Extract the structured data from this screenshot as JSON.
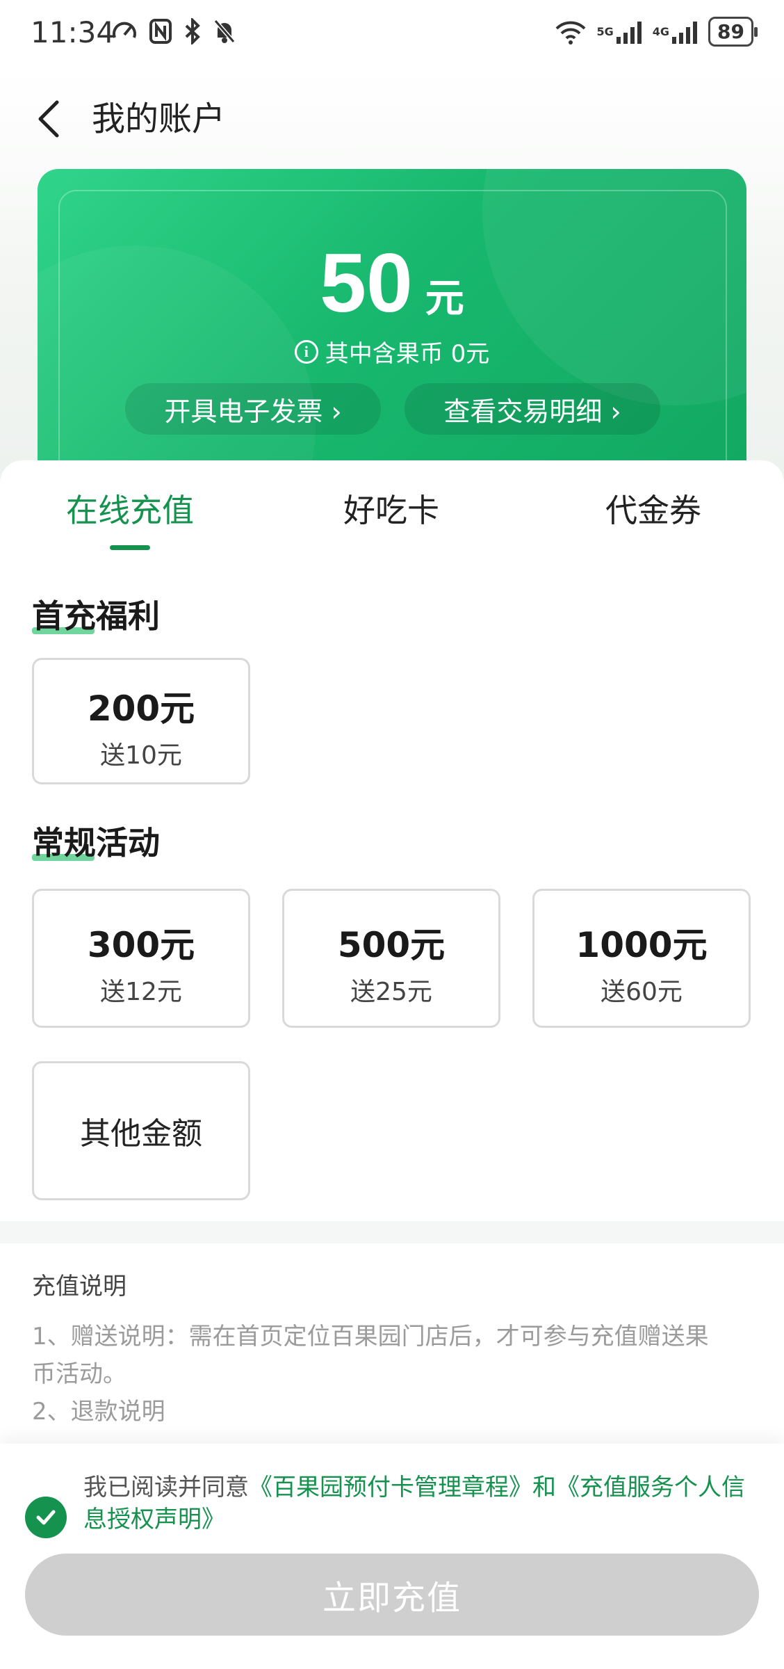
{
  "status_bar": {
    "time": "11:34",
    "battery": "89",
    "network_5g": "5G",
    "network_4g": "4G",
    "icons_left": [
      "speed-icon",
      "nfc-icon",
      "bluetooth-icon",
      "mute-bell-icon"
    ],
    "icons_right": [
      "wifi-icon",
      "signal-icon",
      "signal-icon"
    ]
  },
  "header": {
    "title": "我的账户"
  },
  "balance": {
    "amount": "50",
    "unit": "元",
    "sub_text": "其中含果币 0元",
    "invoice_btn": "开具电子发票 ›",
    "detail_btn": "查看交易明细 ›"
  },
  "tabs": [
    {
      "label": "在线充值",
      "active": true
    },
    {
      "label": "好吃卡",
      "active": false
    },
    {
      "label": "代金券",
      "active": false
    }
  ],
  "first_charge": {
    "title": "首充福利",
    "options": [
      {
        "amount": "200元",
        "gift": "送10元"
      }
    ]
  },
  "regular": {
    "title": "常规活动",
    "options": [
      {
        "amount": "300元",
        "gift": "送12元"
      },
      {
        "amount": "500元",
        "gift": "送25元"
      },
      {
        "amount": "1000元",
        "gift": "送60元"
      }
    ],
    "other_label": "其他金额"
  },
  "notes": {
    "title": "充值说明",
    "lines": [
      "1、赠送说明：需在首页定位百果园门店后，才可参与充值赠送果",
      "币活动。",
      "2、退款说明"
    ]
  },
  "agreement": {
    "prefix": "我已阅读并同意",
    "link1": "《百果园预付卡管理章程》",
    "and": "和",
    "link2": "《充值服务个人信息授权声明》"
  },
  "recharge_button": "立即充值",
  "colors": {
    "accent": "#14924e",
    "card_green": "#18b86f",
    "disabled_button": "#cfcfcf"
  }
}
